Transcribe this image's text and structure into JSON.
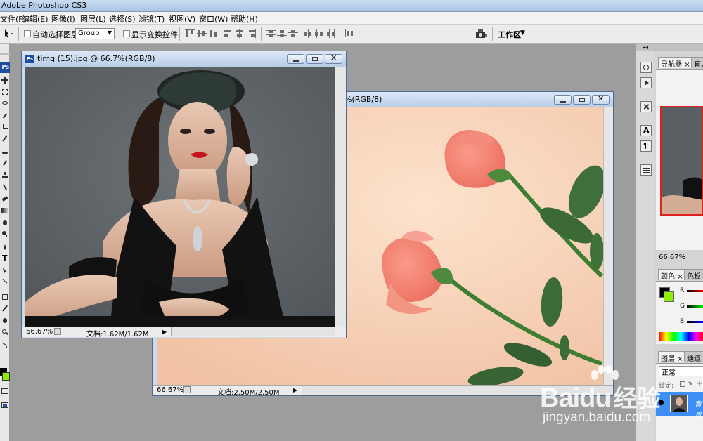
{
  "app": {
    "title": "Adobe Photoshop CS3"
  },
  "menu": [
    "文件(F)",
    "编辑(E)",
    "图像(I)",
    "图层(L)",
    "选择(S)",
    "滤镜(T)",
    "视图(V)",
    "窗口(W)",
    "帮助(H)"
  ],
  "options": {
    "auto_select_label": "自动选择图层",
    "group_value": "Group",
    "transform_label": "显示变换控件",
    "workspace_label": "工作区"
  },
  "tools": {
    "logo": "Ps"
  },
  "doc1": {
    "title": "timg (15).jpg @ 66.7%(RGB/8)",
    "zoom": "66.67%",
    "doc_size": "文档:1.62M/1.62M"
  },
  "doc2": {
    "title_fragment": "7%(RGB/8)",
    "zoom": "66.67%",
    "doc_size": "文档:2.50M/2.50M"
  },
  "navigator": {
    "tab": "导航器",
    "tab2": "直方",
    "zoom": "66.67%"
  },
  "color": {
    "tab": "颜色",
    "tab2": "色板",
    "r": "R",
    "g": "G",
    "b": "B",
    "fg_color": "#000000",
    "bg_color": "#8cf000"
  },
  "layers": {
    "tab": "图层",
    "tab2": "通道",
    "blend_mode": "正常",
    "lock_label": "锁定:",
    "layer_name": "背景"
  },
  "watermark": {
    "brand": "Baidu",
    "brand_cn": "经验",
    "url": "jingyan.baidu.com"
  }
}
